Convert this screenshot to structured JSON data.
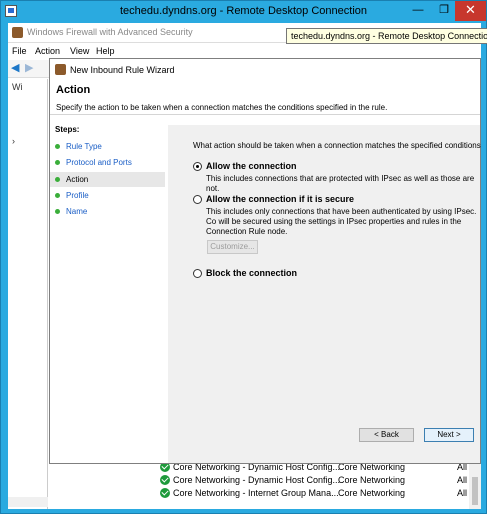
{
  "rdp": {
    "title": "techedu.dyndns.org - Remote Desktop Connection",
    "tooltip": "techedu.dyndns.org - Remote Desktop Connection",
    "minimize": "—",
    "maximize": "❐",
    "close": "✕"
  },
  "mmc": {
    "title": "Windows Firewall with Advanced Security",
    "menu": [
      "File",
      "Action",
      "View",
      "Help"
    ],
    "tree_labels": [
      "Wi",
      "›"
    ],
    "rules": [
      {
        "name": "Core Networking - Dynamic Host Config...",
        "group": "Core Networking",
        "profile": "All"
      },
      {
        "name": "Core Networking - Dynamic Host Config...",
        "group": "Core Networking",
        "profile": "All"
      },
      {
        "name": "Core Networking - Internet Group Mana...",
        "group": "Core Networking",
        "profile": "All"
      }
    ]
  },
  "wizard": {
    "title": "New Inbound Rule Wizard",
    "heading": "Action",
    "description": "Specify the action to be taken when a connection matches the conditions specified in the rule.",
    "steps_title": "Steps:",
    "steps": [
      {
        "label": "Rule Type",
        "current": false
      },
      {
        "label": "Protocol and Ports",
        "current": false
      },
      {
        "label": "Action",
        "current": true
      },
      {
        "label": "Profile",
        "current": false
      },
      {
        "label": "Name",
        "current": false
      }
    ],
    "question": "What action should be taken when a connection matches the specified conditions?",
    "options": [
      {
        "label": "Allow the connection",
        "desc": "This includes connections that are protected with IPsec as well as those are not.",
        "selected": true
      },
      {
        "label": "Allow the connection if it is secure",
        "desc": "This includes only connections that have been authenticated by using IPsec.  Co will be secured using the settings in IPsec properties and rules in the Connection Rule node.",
        "selected": false
      },
      {
        "label": "Block the connection",
        "desc": "",
        "selected": false
      }
    ],
    "customize_label": "Customize...",
    "back_label": "< Back",
    "next_label": "Next >"
  },
  "colors": {
    "rdp_frame": "#2aaae0",
    "close_button": "#c7372d",
    "link": "#1a5ec6",
    "step_dot": "#3aae3a",
    "content_bg": "#f0f0f0"
  }
}
